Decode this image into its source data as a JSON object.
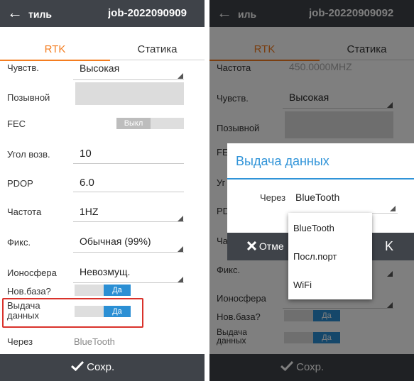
{
  "left_screen": {
    "topbar": {
      "back_glyph": "←",
      "title": "тиль",
      "job_name": "job-2022090909"
    },
    "tabs": [
      {
        "label": "RTK"
      },
      {
        "label": "Статика"
      }
    ],
    "fields": {
      "sens": {
        "label": "Чувств.",
        "value": "Высокая"
      },
      "callsign": {
        "label": "Позывной",
        "value": ""
      },
      "fec": {
        "label": "FEC",
        "toggle": "Выкл"
      },
      "elev": {
        "label": "Угол возв.",
        "value": "10"
      },
      "pdop": {
        "label": "PDOP",
        "value": "6.0"
      },
      "freq": {
        "label": "Частота",
        "value": "1HZ"
      },
      "fix": {
        "label": "Фикс.",
        "value": "Обычная (99%)"
      },
      "iono": {
        "label": "Ионосфера",
        "value": "Невозмущ."
      },
      "newbase": {
        "label": "Нов.база?",
        "toggle": "Да"
      },
      "output": {
        "label_line1": "Выдача",
        "label_line2": "данных",
        "toggle": "Да"
      },
      "via": {
        "label": "Через",
        "value": "BlueTooth"
      }
    },
    "save_label": "Сохр.",
    "save_icon": "checkmark-icon"
  },
  "right_screen": {
    "topbar": {
      "back_glyph": "←",
      "title": "иль",
      "job_name": "job-20220909092"
    },
    "tabs": [
      {
        "label": "RTK"
      },
      {
        "label": "Статика"
      }
    ],
    "fields": {
      "freq": {
        "label": "Частота",
        "value": "450.0000MHZ"
      },
      "sens": {
        "label": "Чувств.",
        "value": "Высокая"
      },
      "callsign": {
        "label": "Позывной"
      },
      "fec_partial": {
        "label": "FE"
      },
      "elev_partial": {
        "label": "Уг"
      },
      "pdop_partial": {
        "label": "PD"
      },
      "freq_partial": {
        "label": "Ча"
      },
      "fix": {
        "label": "Фикс."
      },
      "iono": {
        "label": "Ионосфера"
      },
      "newbase": {
        "label": "Нов.база?",
        "toggle": "Да"
      },
      "output": {
        "label_line1": "Выдача",
        "label_line2": "данных",
        "toggle": "Да"
      }
    },
    "save_label": "Сохр.",
    "dialog": {
      "title": "Выдача данных",
      "via_label": "Через",
      "via_value": "BlueTooth",
      "cancel_label": "Отме",
      "cancel_icon": "close-icon",
      "ok_glyph": "K"
    },
    "dropdown_options": [
      {
        "label": "BlueTooth"
      },
      {
        "label": "Посл.порт"
      },
      {
        "label": "WiFi"
      }
    ]
  },
  "colors": {
    "accent_orange": "#f47d20",
    "toggle_blue": "#2b8fd4",
    "dialog_blue": "#2f93d8",
    "bar_dark": "#3f4349",
    "highlight_red": "#d9322b"
  }
}
